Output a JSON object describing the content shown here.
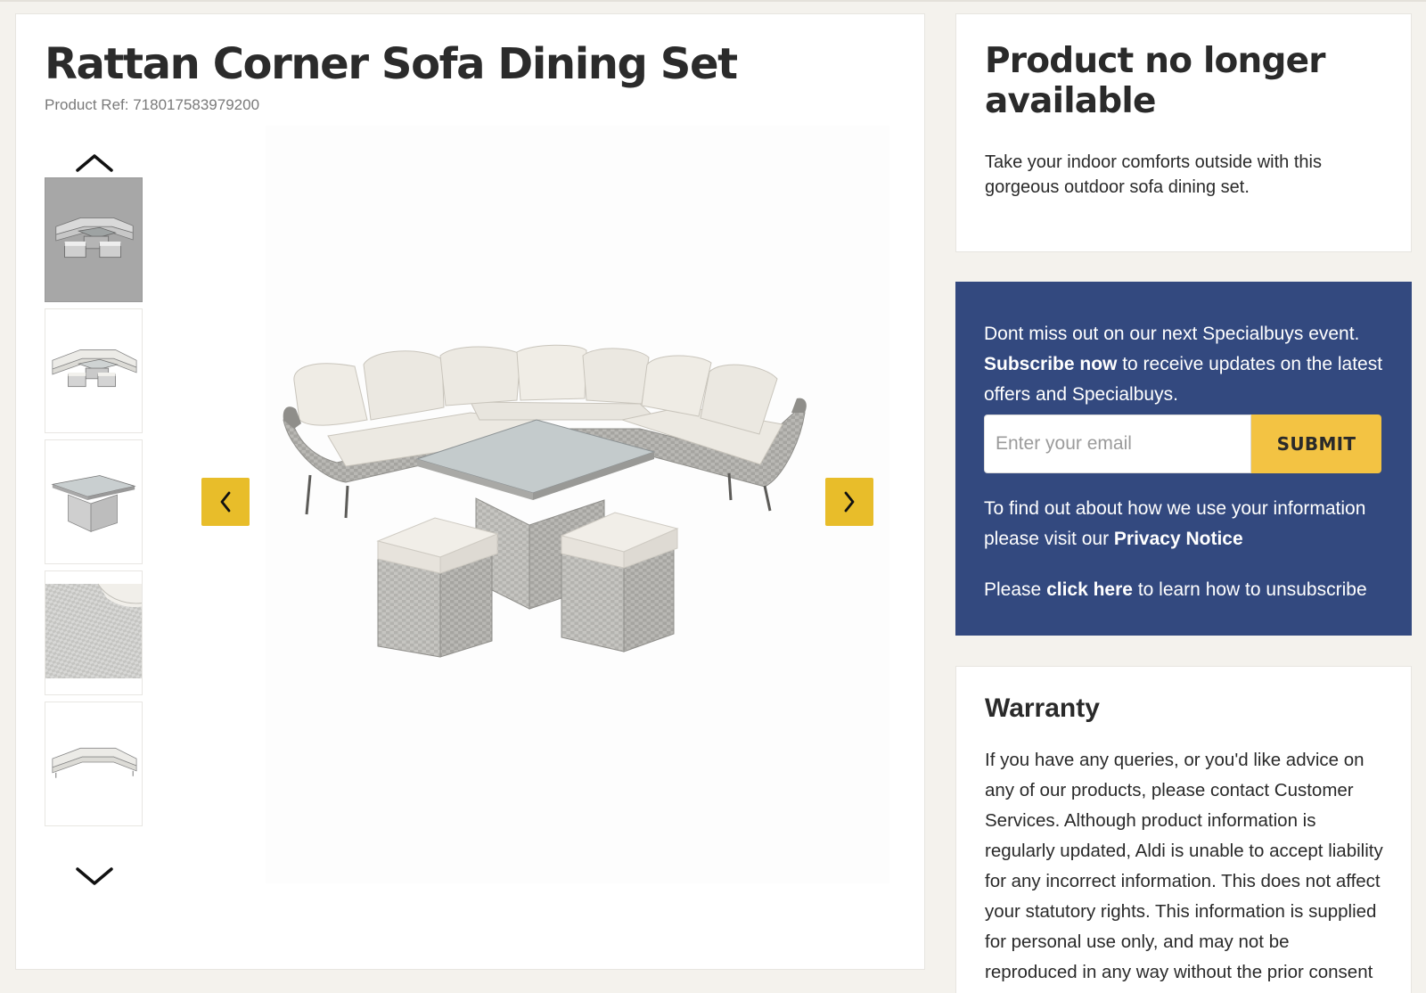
{
  "product": {
    "title": "Rattan Corner Sofa Dining Set",
    "ref_label": "Product Ref: 718017583979200"
  },
  "gallery": {
    "thumbnails": [
      {
        "name": "thumbnail-full-set-grey"
      },
      {
        "name": "thumbnail-full-set"
      },
      {
        "name": "thumbnail-table"
      },
      {
        "name": "thumbnail-rattan-detail"
      },
      {
        "name": "thumbnail-sofa-only"
      }
    ],
    "active_index": 0,
    "accent_color": "#e8bd2a"
  },
  "availability": {
    "title": "Product no longer available",
    "description": "Take your indoor comforts outside with this gorgeous outdoor sofa dining set."
  },
  "signup": {
    "intro": "Dont miss out on our next Specialbuys event.",
    "subscribe_link": "Subscribe now",
    "intro_rest": "to receive updates on the latest offers and Specialbuys.",
    "email_placeholder": "Enter your email",
    "submit_label": "SUBMIT",
    "privacy_text": "To find out about how we use your information please visit our",
    "privacy_link": "Privacy Notice",
    "unsub_prefix": "Please",
    "unsub_link": "click here",
    "unsub_suffix": "to learn how to unsubscribe",
    "background_color": "#33497f",
    "button_color": "#f3c343"
  },
  "warranty": {
    "title": "Warranty",
    "text": "If you have any queries, or you'd like advice on any of our products, please contact Customer Services. Although product information is regularly updated, Aldi is unable to accept liability for any incorrect information. This does not affect your statutory rights. This information is supplied for personal use only, and may not be reproduced in any way without the prior consent of Aldi nor without"
  },
  "icons": {
    "up": "chevron-up-icon",
    "down": "chevron-down-icon",
    "prev": "chevron-left-icon",
    "next": "chevron-right-icon"
  }
}
